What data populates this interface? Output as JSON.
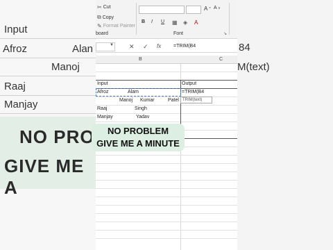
{
  "left_bg": {
    "input": "Input",
    "afroz": "Afroz",
    "alam": "Alan",
    "manoj": "Manoj",
    "raaj": "Raaj",
    "manjay": "Manjay",
    "overlay_line1": "NO PRO",
    "overlay_line2": "GIVE ME A"
  },
  "right_bg": {
    "ref": "84",
    "hint": "M(text)"
  },
  "ribbon": {
    "cut": "Cut",
    "copy": "Copy",
    "format_painter": "Format Painter",
    "clipboard": "board",
    "bold": "B",
    "italic": "I",
    "underline": "U",
    "font_group": "Font"
  },
  "formula_bar": {
    "cancel_glyph": "✕",
    "enter_glyph": "✓",
    "fx": "fx",
    "formula": "=TRIM(B4"
  },
  "columns": {
    "b": "B",
    "c": "C"
  },
  "cells": {
    "input_header": "Input",
    "output_header": "Output",
    "r1_first": "Afroz",
    "r1_last": "Alam",
    "r1_formula": "=TRIM(B4",
    "r2_a": "Manoj",
    "r2_b": "Kumar",
    "r2_c": "Patel",
    "r3_first": "Raaj",
    "r3_last": "Singh",
    "r4_first": "Manjay",
    "r4_last": "Yadav"
  },
  "tooltip": "TRIM(text)",
  "caption": {
    "line1": "NO PROBLEM",
    "line2": "GIVE ME A MINUTE"
  }
}
